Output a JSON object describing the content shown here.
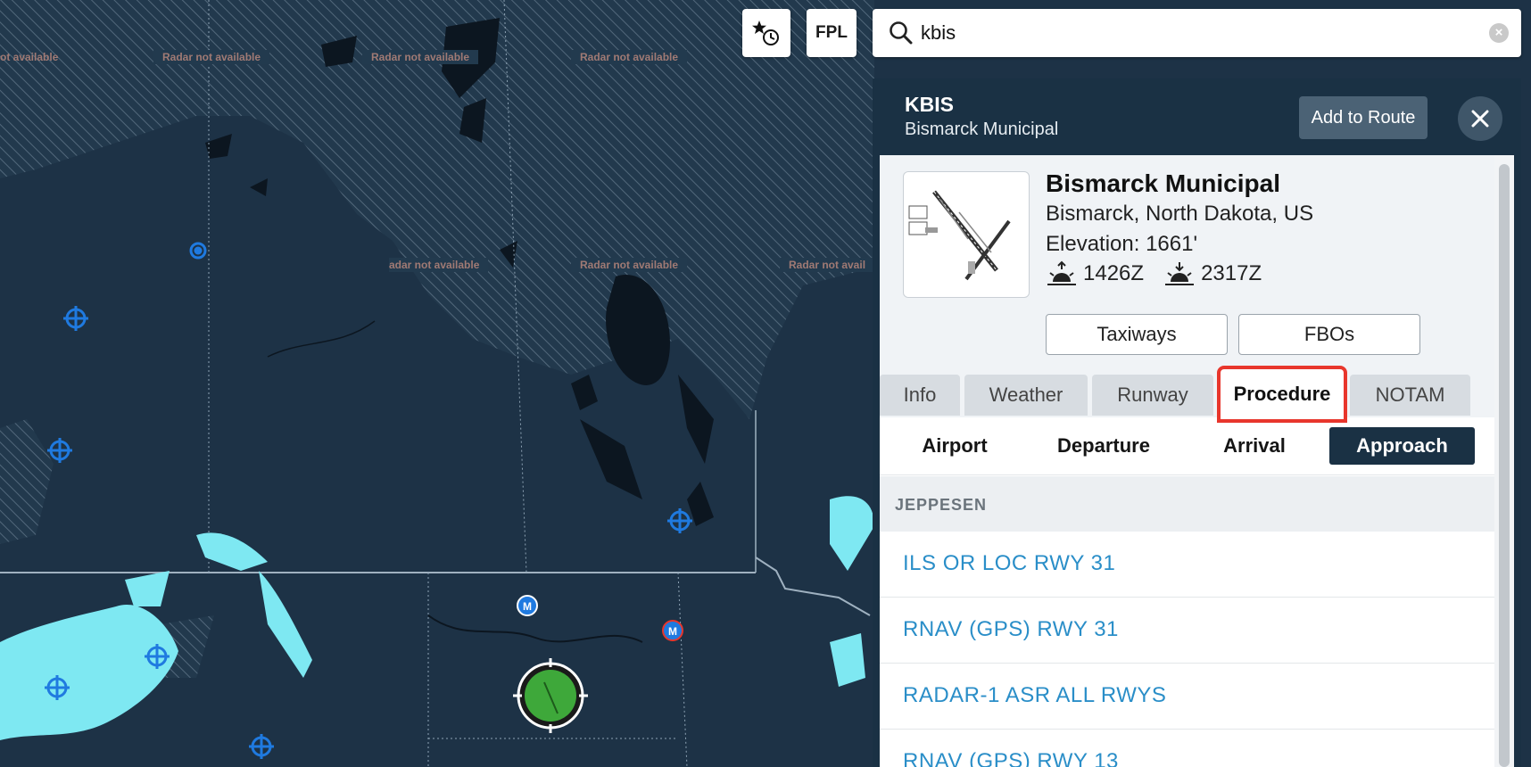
{
  "map": {
    "radar_labels": [
      "ot available",
      "Radar not available",
      "Radar not available",
      "Radar not available",
      "Radar not available",
      "Radar not available",
      "Radar not available",
      "Radar not available",
      "adar not available",
      "Radar not available",
      "Radar not avail"
    ],
    "colors": {
      "land": "#1d3246",
      "hatch": "#4c6478",
      "radar_precip": "#7ee8f2",
      "waypoint": "#1f7ae0",
      "ownship": "#3ea83a"
    },
    "waypoint_icons": [
      "vor-icon",
      "vor-icon",
      "vor-icon",
      "vor-icon",
      "vor-icon",
      "vor-icon",
      "vor-icon"
    ]
  },
  "toolbar": {
    "favorites_icon": "star-clock-icon",
    "fpl_label": "FPL"
  },
  "search": {
    "value": "kbis",
    "placeholder": ""
  },
  "panel": {
    "airport_id": "KBIS",
    "subtitle": "Bismarck Municipal",
    "add_to_route_label": "Add to Route",
    "close_icon": "close-icon"
  },
  "info": {
    "name": "Bismarck Municipal",
    "location": "Bismarck, North Dakota, US",
    "elevation": "Elevation: 1661'",
    "sunrise": "1426Z",
    "sunset": "2317Z",
    "taxiways_label": "Taxiways",
    "fbos_label": "FBOs"
  },
  "tabs": [
    {
      "label": "Info",
      "active": false
    },
    {
      "label": "Weather",
      "active": false
    },
    {
      "label": "Runway",
      "active": false
    },
    {
      "label": "Procedure",
      "active": true
    },
    {
      "label": "NOTAM",
      "active": false
    }
  ],
  "subtabs": [
    {
      "label": "Airport",
      "active": false
    },
    {
      "label": "Departure",
      "active": false
    },
    {
      "label": "Arrival",
      "active": false
    },
    {
      "label": "Approach",
      "active": true
    }
  ],
  "section_label": "JEPPESEN",
  "procedures": [
    "ILS OR LOC RWY 31",
    "RNAV (GPS) RWY 31",
    "RADAR-1 ASR ALL RWYS",
    "RNAV (GPS) RWY 13"
  ],
  "accent": {
    "highlight": "#e8362c",
    "link": "#2a8ec8",
    "header": "#1a3144"
  }
}
